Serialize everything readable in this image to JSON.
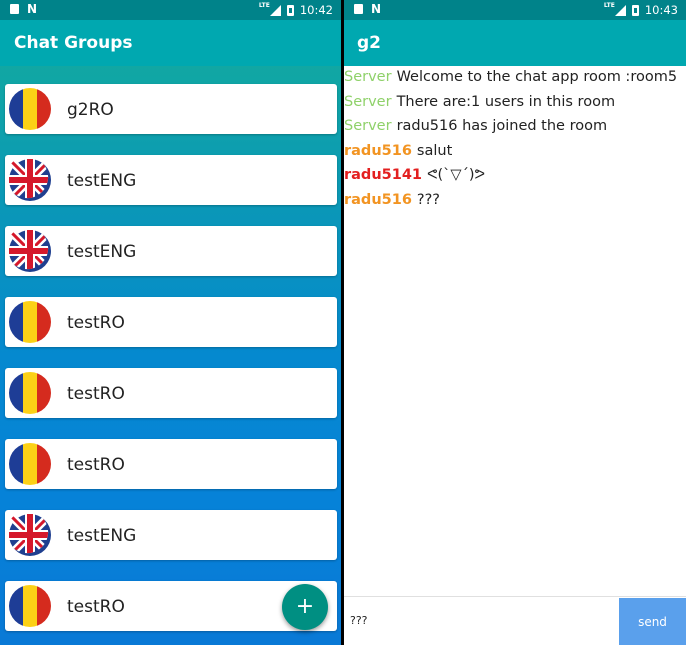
{
  "colors": {
    "status_bar": "#00838a",
    "app_bar": "#00a8b0",
    "fab": "#008f82",
    "send_button": "#5aa0ec",
    "server_name": "#8fd16a",
    "user_orange": "#f29422",
    "user_red": "#e32020"
  },
  "left": {
    "status": {
      "time": "10:42",
      "lte": "LTE"
    },
    "app_title": "Chat Groups",
    "groups": [
      {
        "name": "g2RO",
        "flag": "romania-flag-icon"
      },
      {
        "name": "testENG",
        "flag": "uk-flag-icon"
      },
      {
        "name": "testENG",
        "flag": "uk-flag-icon"
      },
      {
        "name": "testRO",
        "flag": "romania-flag-icon"
      },
      {
        "name": "testRO",
        "flag": "romania-flag-icon"
      },
      {
        "name": "testRO",
        "flag": "romania-flag-icon"
      },
      {
        "name": "testENG",
        "flag": "uk-flag-icon"
      },
      {
        "name": "testRO",
        "flag": "romania-flag-icon"
      }
    ],
    "fab_label": "+"
  },
  "right": {
    "status": {
      "time": "10:43",
      "lte": "LTE"
    },
    "app_title": "g2",
    "messages": [
      {
        "sender": "Server",
        "text": "Welcome to the chat app room :room5",
        "color": "#8fd16a",
        "bold": false
      },
      {
        "sender": "Server",
        "text": "There are:1 users in this room",
        "color": "#8fd16a",
        "bold": false
      },
      {
        "sender": "Server",
        "text": "radu516 has joined the room",
        "color": "#8fd16a",
        "bold": false
      },
      {
        "sender": "radu516",
        "text": "salut",
        "color": "#f29422",
        "bold": true
      },
      {
        "sender": "radu5141",
        "text": "ᕙ(`▽´)ᕗ",
        "color": "#e32020",
        "bold": true
      },
      {
        "sender": "radu516",
        "text": "???",
        "color": "#f29422",
        "bold": true
      }
    ],
    "input_value": "???",
    "send_label": "send"
  }
}
